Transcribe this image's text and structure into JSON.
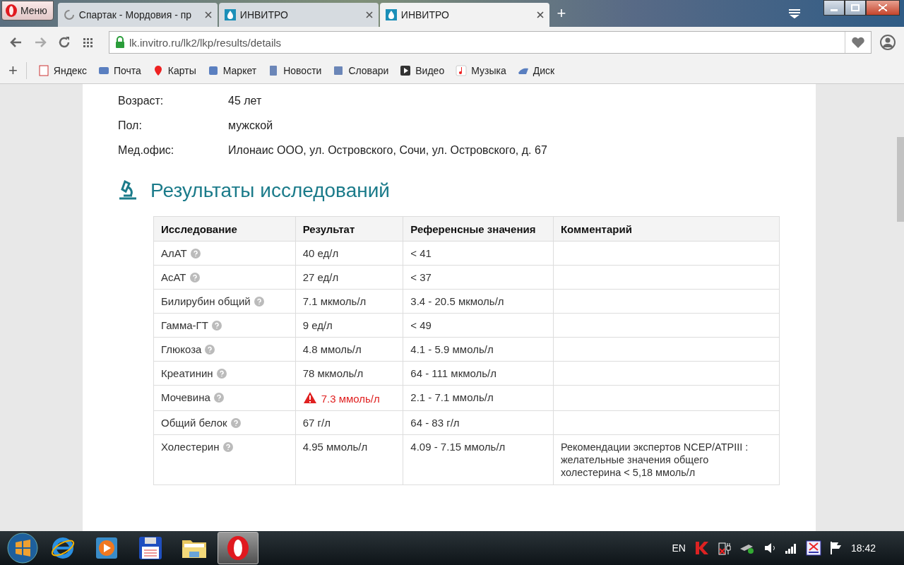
{
  "browser": {
    "menu_label": "Меню",
    "tabs": [
      {
        "title": "Спартак - Мордовия - пр",
        "kind": "loading",
        "selected": false
      },
      {
        "title": "ИНВИТРО",
        "kind": "site",
        "selected": false
      },
      {
        "title": "ИНВИТРО",
        "kind": "site",
        "selected": true
      }
    ],
    "new_tab": "+",
    "url": "lk.invitro.ru/lk2/lkp/results/details",
    "add_bookmark": "+",
    "bookmarks": [
      {
        "label": "Яндекс",
        "kind": "yandex"
      },
      {
        "label": "Почта",
        "kind": "mail"
      },
      {
        "label": "Карты",
        "kind": "maps"
      },
      {
        "label": "Маркет",
        "kind": "market"
      },
      {
        "label": "Новости",
        "kind": "news"
      },
      {
        "label": "Словари",
        "kind": "dict"
      },
      {
        "label": "Видео",
        "kind": "video"
      },
      {
        "label": "Музыка",
        "kind": "music"
      },
      {
        "label": "Диск",
        "kind": "disk"
      }
    ]
  },
  "patient": [
    {
      "label": "Возраст:",
      "value": "45 лет"
    },
    {
      "label": "Пол:",
      "value": "мужской"
    },
    {
      "label": "Мед.офис:",
      "value": "Илонаис ООО, ул. Островского, Сочи, ул. Островского, д. 67"
    }
  ],
  "results": {
    "title": "Результаты исследований",
    "columns": [
      "Исследование",
      "Результат",
      "Референсные значения",
      "Комментарий"
    ],
    "rows": [
      {
        "test": "АлАТ",
        "result": "40 ед/л",
        "reference": "< 41",
        "out_of_range": false
      },
      {
        "test": "АсАТ",
        "result": "27 ед/л",
        "reference": "< 37",
        "out_of_range": false
      },
      {
        "test": "Билирубин общий",
        "result": "7.1 мкмоль/л",
        "reference": "3.4 - 20.5 мкмоль/л",
        "out_of_range": false
      },
      {
        "test": "Гамма-ГТ",
        "result": "9 ед/л",
        "reference": "< 49",
        "out_of_range": false
      },
      {
        "test": "Глюкоза",
        "result": "4.8 ммоль/л",
        "reference": "4.1 - 5.9 ммоль/л",
        "out_of_range": false
      },
      {
        "test": "Креатинин",
        "result": "78 мкмоль/л",
        "reference": "64 - 111 мкмоль/л",
        "out_of_range": false
      },
      {
        "test": "Мочевина",
        "result": "7.3 ммоль/л",
        "reference": "2.1 - 7.1 ммоль/л",
        "out_of_range": true
      },
      {
        "test": "Общий белок",
        "result": "67 г/л",
        "reference": "64 - 83 г/л",
        "out_of_range": false
      },
      {
        "test": "Холестерин",
        "result": "4.95 ммоль/л",
        "reference": "4.09 - 7.15 ммоль/л",
        "comment": "Рекомендации экспертов NCEP/ATPIII : желательные значения общего холестерина < 5,18 ммоль/л",
        "out_of_range": false
      }
    ]
  },
  "taskbar": {
    "apps": [
      {
        "kind": "ie",
        "active": false
      },
      {
        "kind": "media",
        "active": false
      },
      {
        "kind": "save",
        "active": false
      },
      {
        "kind": "folder",
        "active": false
      },
      {
        "kind": "opera",
        "active": true
      }
    ],
    "language": "EN",
    "time": "18:42"
  }
}
